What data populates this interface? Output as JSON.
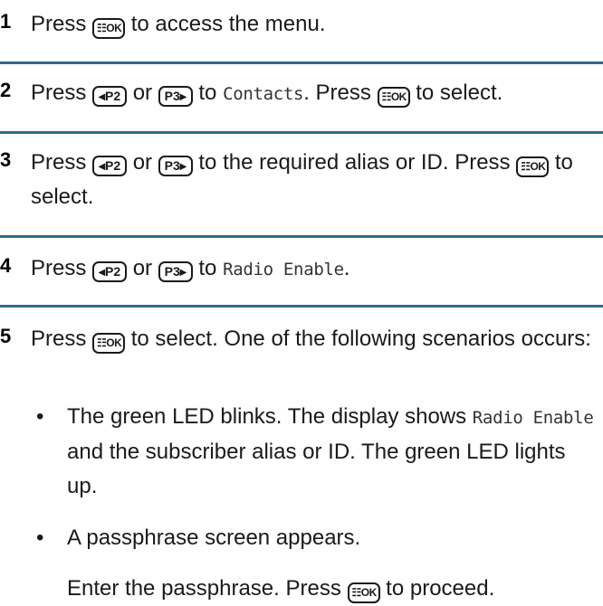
{
  "steps": [
    {
      "number": "1",
      "parts": [
        "Press",
        "to access the menu."
      ],
      "keys": [
        "OK"
      ]
    },
    {
      "number": "2",
      "parts": [
        "Press",
        "or",
        "to",
        "Contacts",
        ". Press",
        "to select."
      ],
      "keys": [
        "P2",
        "P3",
        "OK"
      ]
    },
    {
      "number": "3",
      "parts": [
        "Press",
        "or",
        "to the required alias or ID. Press",
        "to select."
      ],
      "keys": [
        "P2",
        "P3",
        "OK"
      ]
    },
    {
      "number": "4",
      "parts": [
        "Press",
        "or",
        "to",
        "Radio Enable",
        "."
      ],
      "keys": [
        "P2",
        "P3"
      ]
    },
    {
      "number": "5",
      "parts": [
        "Press",
        "to select. One of the following scenarios occurs:"
      ],
      "keys": [
        "OK"
      ],
      "bullets": [
        {
          "parts": [
            "The green LED blinks. The display shows",
            "Radio Enable",
            "and the subscriber alias or ID. The green LED lights up."
          ]
        },
        {
          "parts": [
            "A passphrase screen appears."
          ],
          "follow_up": [
            "Enter the passphrase. Press",
            "to proceed."
          ]
        }
      ]
    }
  ],
  "bullet_marker": "•",
  "key_labels": {
    "ok": "☷OK",
    "p2": "◂P2",
    "p3": "P3▸"
  },
  "colors": {
    "separator": "#2f6a8c",
    "text": "#1a1a1a"
  }
}
